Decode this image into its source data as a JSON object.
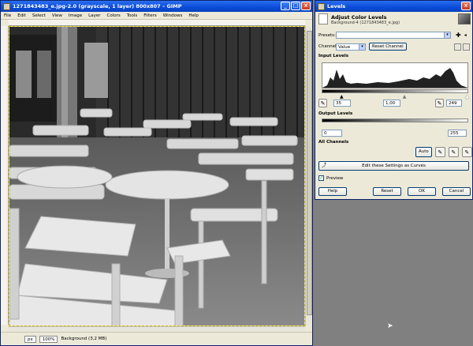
{
  "gimp_window": {
    "title": "1271843483_e.jpg-2.0 (grayscale, 1 layer) 800x807 – GIMP",
    "menu": [
      "File",
      "Edit",
      "Select",
      "View",
      "Image",
      "Layer",
      "Colors",
      "Tools",
      "Filters",
      "Windows",
      "Help"
    ],
    "status": {
      "unit": "px",
      "zoom": "100%",
      "layer_info": "Background (3,2 MB)"
    }
  },
  "levels_dialog": {
    "title": "Levels",
    "heading": "Adjust Color Levels",
    "subheading": "Background-4 (1271843483_e.jpg)",
    "presets_label": "Presets:",
    "channel_label": "Channel:",
    "channel_value": "Value",
    "reset_channel_label": "Reset Channel",
    "input_levels_label": "Input Levels",
    "input_low": "35",
    "input_gamma": "1,00",
    "input_high": "249",
    "output_levels_label": "Output Levels",
    "output_low": "0",
    "output_high": "255",
    "all_channels_label": "All Channels",
    "auto_label": "Auto",
    "edit_curves_label": "Edit these Settings as Curves",
    "preview_label": "Preview",
    "preview_checked": true,
    "buttons": {
      "help": "Help",
      "reset": "Reset",
      "ok": "OK",
      "cancel": "Cancel"
    }
  },
  "colors": {
    "titlebar": "#0a4bd8",
    "dialog_bg": "#ece9d8",
    "desktop": "#808080"
  }
}
